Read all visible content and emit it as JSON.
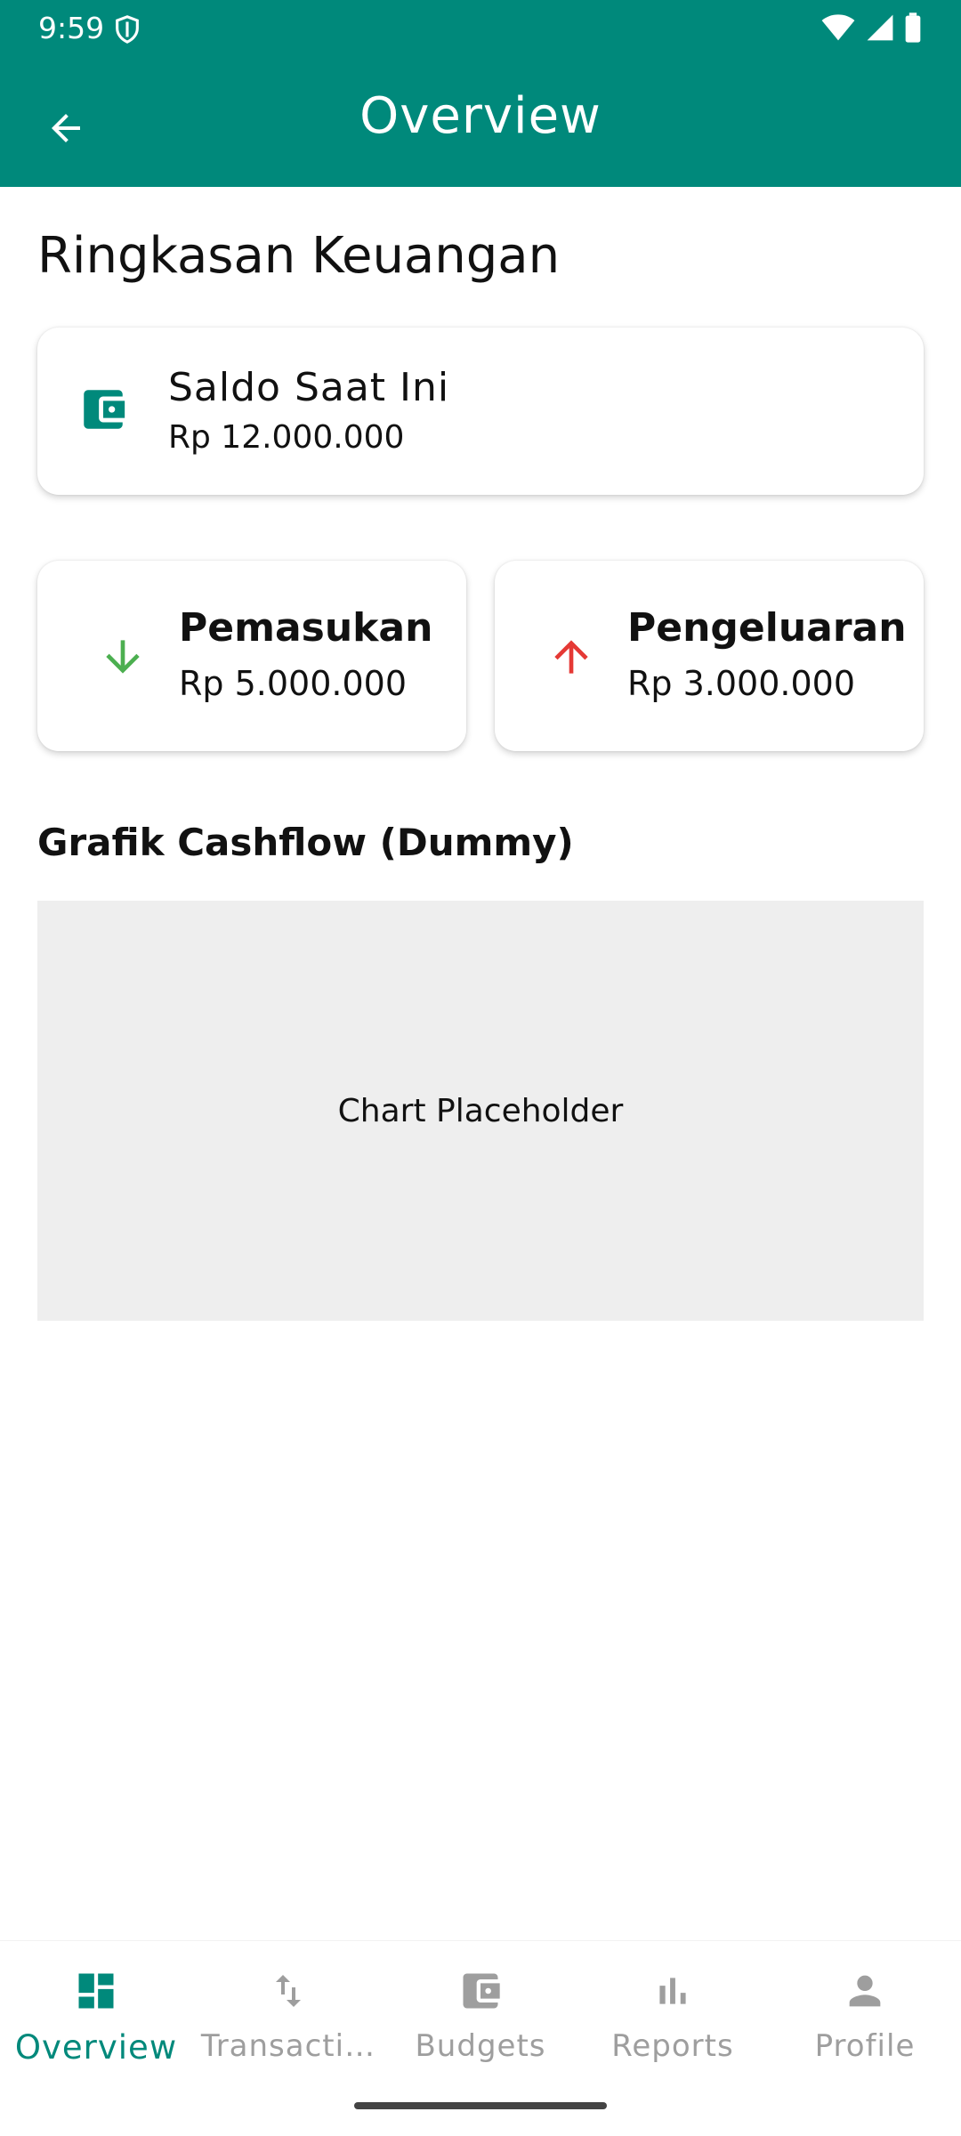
{
  "status_bar": {
    "time": "9:59"
  },
  "app_bar": {
    "title": "Overview"
  },
  "summary": {
    "title": "Ringkasan Keuangan"
  },
  "balance": {
    "label": "Saldo Saat Ini",
    "value": "Rp 12.000.000"
  },
  "income": {
    "label": "Pemasukan",
    "value": "Rp 5.000.000"
  },
  "expense": {
    "label": "Pengeluaran",
    "value": "Rp 3.000.000"
  },
  "chart": {
    "title": "Grafik Cashflow (Dummy)",
    "placeholder": "Chart Placeholder"
  },
  "bottom_nav": {
    "items": [
      {
        "label": "Overview",
        "icon": "dashboard-icon",
        "active": true
      },
      {
        "label": "Transacti…",
        "icon": "swap-vertical-icon",
        "active": false
      },
      {
        "label": "Budgets",
        "icon": "wallet-icon",
        "active": false
      },
      {
        "label": "Reports",
        "icon": "bar-chart-icon",
        "active": false
      },
      {
        "label": "Profile",
        "icon": "person-icon",
        "active": false
      }
    ]
  },
  "colors": {
    "primary": "#00897b",
    "income": "#4caf50",
    "expense": "#e53935",
    "inactive": "#9e9e9e",
    "chart_bg": "#eeeeee"
  }
}
